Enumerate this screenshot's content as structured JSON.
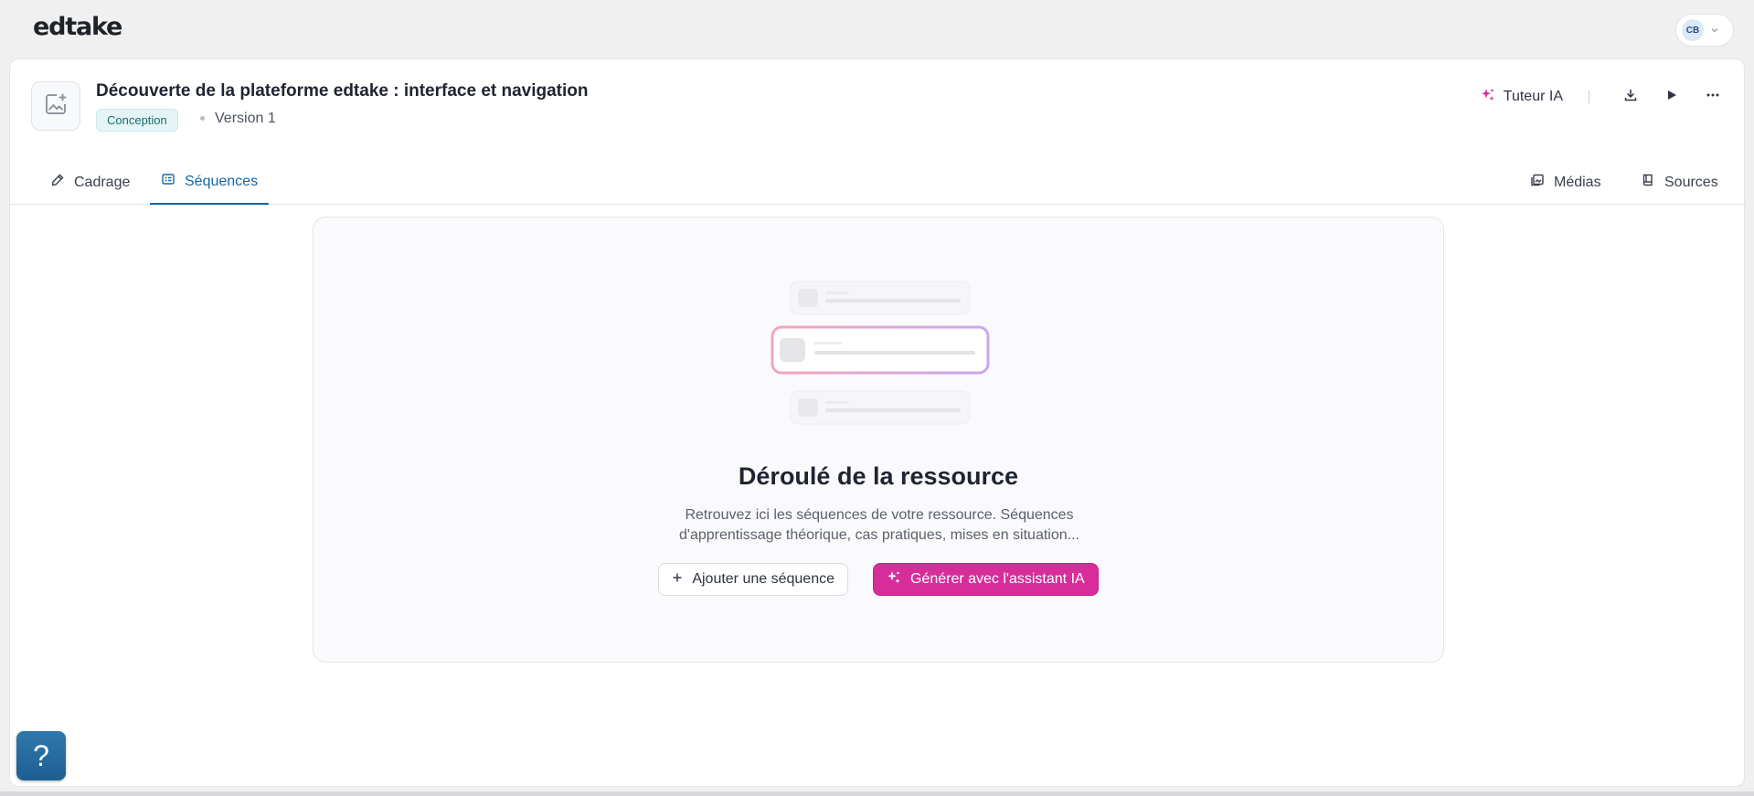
{
  "app": {
    "logo": "edtake"
  },
  "user": {
    "initials": "CB"
  },
  "resource": {
    "title": "Découverte de la plateforme edtake : interface et navigation",
    "status": "Conception",
    "version": "Version 1"
  },
  "actions": {
    "ai_tutor": "Tuteur IA"
  },
  "tabs": {
    "left": [
      {
        "label": "Cadrage",
        "icon": "pen-icon"
      },
      {
        "label": "Séquences",
        "icon": "list-icon",
        "active": true
      }
    ],
    "right": [
      {
        "label": "Médias",
        "icon": "media-icon"
      },
      {
        "label": "Sources",
        "icon": "book-icon"
      }
    ]
  },
  "empty_state": {
    "title": "Déroulé de la ressource",
    "description": "Retrouvez ici les séquences de votre ressource. Séquences d'apprentissage théorique, cas pratiques, mises en situation...",
    "add_button": "Ajouter une séquence",
    "ai_button": "Générer avec l'assistant IA"
  },
  "help": {
    "label": "?"
  },
  "colors": {
    "accent": "#1666a8",
    "ai_pink": "#d72d9b",
    "badge_bg": "#e5f5f6",
    "badge_text": "#176b74"
  }
}
